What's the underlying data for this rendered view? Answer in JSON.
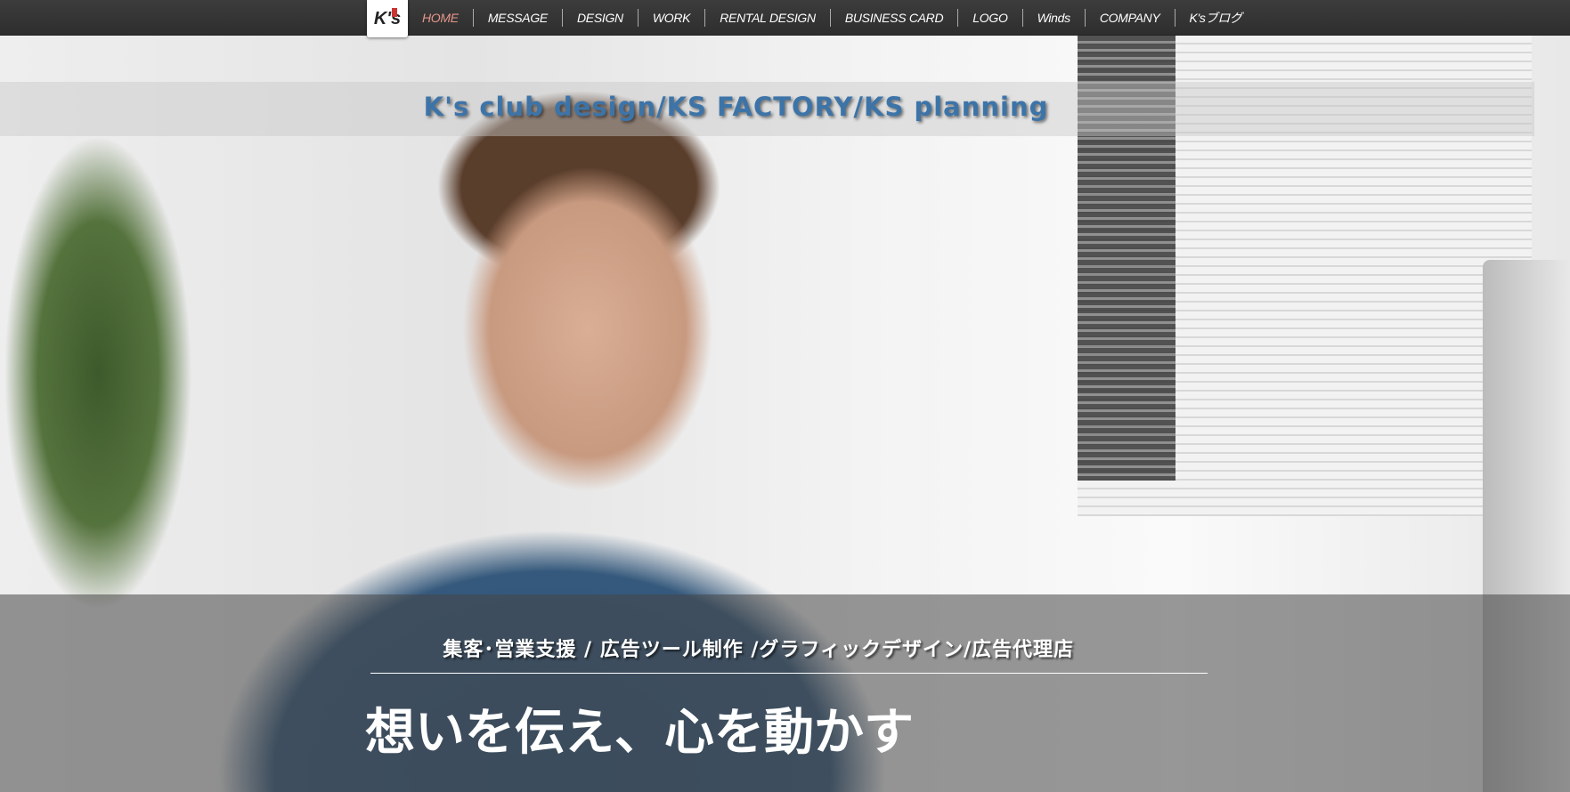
{
  "nav": {
    "logo_text": "K's",
    "items": [
      {
        "label": "HOME"
      },
      {
        "label": "MESSAGE"
      },
      {
        "label": "DESIGN"
      },
      {
        "label": "WORK"
      },
      {
        "label": "RENTAL DESIGN"
      },
      {
        "label": "BUSINESS CARD"
      },
      {
        "label": "LOGO"
      },
      {
        "label": "Winds"
      },
      {
        "label": "COMPANY"
      },
      {
        "label": "K'sブログ"
      }
    ],
    "active_color": "#e5958a"
  },
  "hero": {
    "title": "K's club design/KS FACTORY/KS planning",
    "subtitle": "集客･営業支援 / 広告ツール制作 /グラフィックデザイン/広告代理店",
    "headline": "想いを伝え、心を動かす"
  }
}
